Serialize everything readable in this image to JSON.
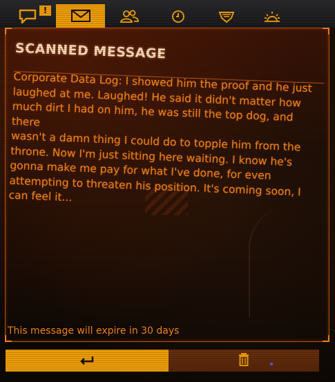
{
  "tabs": [
    {
      "id": "comms",
      "icon": "chat-bubble-icon",
      "alert": "!",
      "active": false
    },
    {
      "id": "inbox",
      "icon": "envelope-icon",
      "active": true
    },
    {
      "id": "contacts",
      "icon": "people-icon",
      "active": false
    },
    {
      "id": "history",
      "icon": "clock-icon",
      "active": false
    },
    {
      "id": "squadron",
      "icon": "shield-wings-icon",
      "active": false
    },
    {
      "id": "settings",
      "icon": "gear-icon",
      "active": false
    }
  ],
  "panel": {
    "title": "SCANNED MESSAGE",
    "message_lines": [
      "Corporate Data Log: I showed him the proof and he just",
      "laughed at me. Laughed! He said it didn't matter how",
      "much dirt I had on him, he was still the top dog, and there",
      "wasn't a damn thing I could do to topple him from the",
      "throne. Now I'm just sitting here waiting. I know he's",
      "gonna make me pay for what I've done, for even",
      "attempting to threaten his position. It's coming soon, I",
      "can feel it..."
    ],
    "expiry_text": "This message will expire in 30 days"
  },
  "buttons": {
    "back_icon": "back-arrow-icon",
    "delete_icon": "trash-icon"
  },
  "colors": {
    "accent": "#f5a20a",
    "text": "#ff8c1a",
    "title": "#ffe3c6",
    "border": "#c65a10",
    "delete_bg": "#5a270a"
  }
}
